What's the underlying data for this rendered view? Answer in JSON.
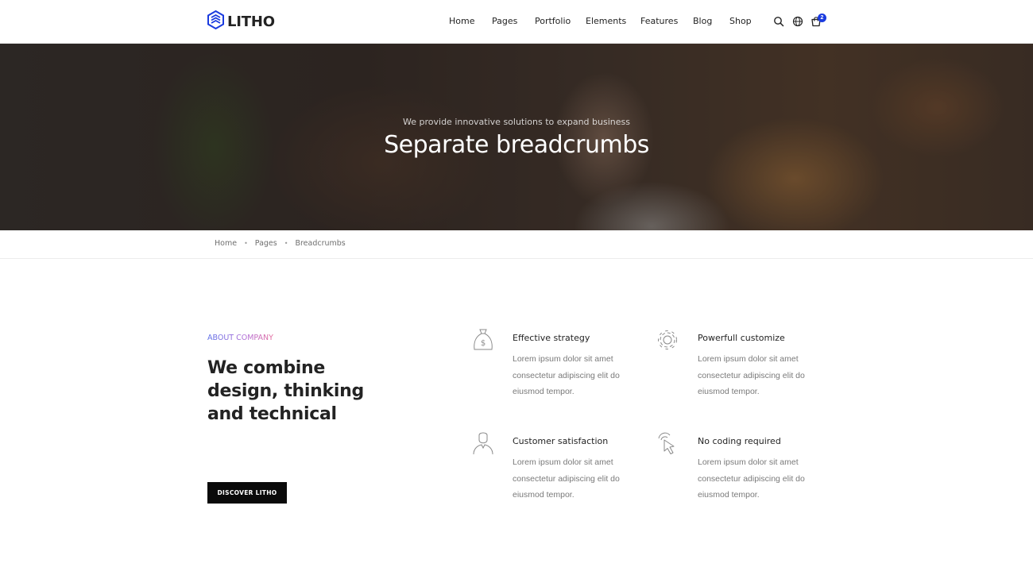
{
  "header": {
    "logo_text": "LITHO",
    "logo_icon": "cube-logo-icon",
    "brand_color": "#1a3bdf",
    "nav": [
      "Home",
      "Pages",
      "Portfolio",
      "Elements",
      "Features",
      "Blog",
      "Shop"
    ],
    "icons": [
      "search-icon",
      "globe-icon",
      "cart-icon"
    ],
    "cart_count": "2"
  },
  "hero": {
    "subtitle": "We provide innovative solutions to expand business",
    "title": "Separate breadcrumbs"
  },
  "breadcrumb": {
    "items": [
      "Home",
      "Pages",
      "Breadcrumbs"
    ],
    "separator": "•"
  },
  "about": {
    "label": "ABOUT COMPANY",
    "title": "We combine design, thinking and technical",
    "button": "DISCOVER LITHO"
  },
  "features": [
    {
      "icon": "money-bag-icon",
      "title": "Effective strategy",
      "text": "Lorem ipsum dolor sit amet consectetur adipiscing elit do eiusmod tempor."
    },
    {
      "icon": "gear-icon",
      "title": "Powerfull customize",
      "text": "Lorem ipsum dolor sit amet consectetur adipiscing elit do eiusmod tempor."
    },
    {
      "icon": "user-icon",
      "title": "Customer satisfaction",
      "text": "Lorem ipsum dolor sit amet consectetur adipiscing elit do eiusmod tempor."
    },
    {
      "icon": "cursor-click-icon",
      "title": "No coding required",
      "text": "Lorem ipsum dolor sit amet consectetur adipiscing elit do eiusmod tempor."
    }
  ]
}
